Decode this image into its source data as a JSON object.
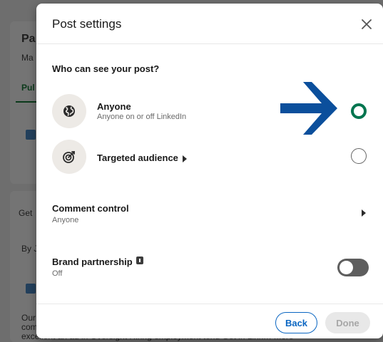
{
  "background": {
    "title_fragment": "Pa",
    "sub_fragment": "Ma",
    "tab_fragment": "Pul",
    "get_fragment": "Get",
    "by_fragment": "By J",
    "bottom_line1": "Our",
    "bottom_line2": "com",
    "bottom_line3": "excellent an ad in Oversight Hiring employment tend Get in Link… more"
  },
  "modal": {
    "title": "Post settings",
    "close_icon": "close-icon",
    "visibility_heading": "Who can see your post?",
    "options": [
      {
        "title": "Anyone",
        "subtitle": "Anyone on or off LinkedIn",
        "icon": "globe-icon",
        "selected": true
      },
      {
        "title": "Targeted audience",
        "subtitle": "",
        "icon": "target-icon",
        "selected": false
      }
    ],
    "comment_control": {
      "title": "Comment control",
      "value": "Anyone"
    },
    "brand_partnership": {
      "title": "Brand partnership",
      "value": "Off",
      "enabled": false
    },
    "footer": {
      "back_label": "Back",
      "done_label": "Done"
    }
  },
  "colors": {
    "accent_blue": "#0a66c2",
    "selected_green": "#01754f",
    "annotation_arrow": "#0b4f9c",
    "toggle_off": "#5e5e5e"
  }
}
